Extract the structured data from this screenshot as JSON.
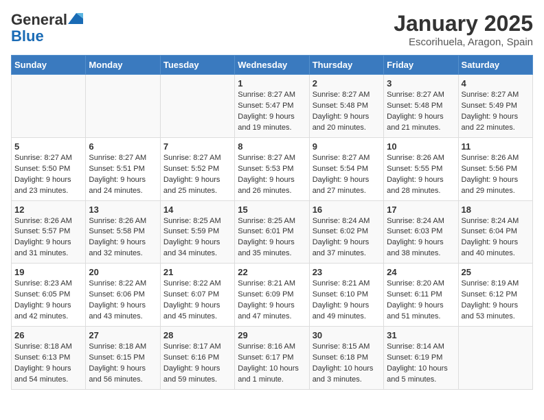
{
  "logo": {
    "general": "General",
    "blue": "Blue"
  },
  "title": "January 2025",
  "location": "Escorihuela, Aragon, Spain",
  "days_header": [
    "Sunday",
    "Monday",
    "Tuesday",
    "Wednesday",
    "Thursday",
    "Friday",
    "Saturday"
  ],
  "weeks": [
    [
      {
        "num": "",
        "sunrise": "",
        "sunset": "",
        "daylight": ""
      },
      {
        "num": "",
        "sunrise": "",
        "sunset": "",
        "daylight": ""
      },
      {
        "num": "",
        "sunrise": "",
        "sunset": "",
        "daylight": ""
      },
      {
        "num": "1",
        "sunrise": "Sunrise: 8:27 AM",
        "sunset": "Sunset: 5:47 PM",
        "daylight": "Daylight: 9 hours and 19 minutes."
      },
      {
        "num": "2",
        "sunrise": "Sunrise: 8:27 AM",
        "sunset": "Sunset: 5:48 PM",
        "daylight": "Daylight: 9 hours and 20 minutes."
      },
      {
        "num": "3",
        "sunrise": "Sunrise: 8:27 AM",
        "sunset": "Sunset: 5:48 PM",
        "daylight": "Daylight: 9 hours and 21 minutes."
      },
      {
        "num": "4",
        "sunrise": "Sunrise: 8:27 AM",
        "sunset": "Sunset: 5:49 PM",
        "daylight": "Daylight: 9 hours and 22 minutes."
      }
    ],
    [
      {
        "num": "5",
        "sunrise": "Sunrise: 8:27 AM",
        "sunset": "Sunset: 5:50 PM",
        "daylight": "Daylight: 9 hours and 23 minutes."
      },
      {
        "num": "6",
        "sunrise": "Sunrise: 8:27 AM",
        "sunset": "Sunset: 5:51 PM",
        "daylight": "Daylight: 9 hours and 24 minutes."
      },
      {
        "num": "7",
        "sunrise": "Sunrise: 8:27 AM",
        "sunset": "Sunset: 5:52 PM",
        "daylight": "Daylight: 9 hours and 25 minutes."
      },
      {
        "num": "8",
        "sunrise": "Sunrise: 8:27 AM",
        "sunset": "Sunset: 5:53 PM",
        "daylight": "Daylight: 9 hours and 26 minutes."
      },
      {
        "num": "9",
        "sunrise": "Sunrise: 8:27 AM",
        "sunset": "Sunset: 5:54 PM",
        "daylight": "Daylight: 9 hours and 27 minutes."
      },
      {
        "num": "10",
        "sunrise": "Sunrise: 8:26 AM",
        "sunset": "Sunset: 5:55 PM",
        "daylight": "Daylight: 9 hours and 28 minutes."
      },
      {
        "num": "11",
        "sunrise": "Sunrise: 8:26 AM",
        "sunset": "Sunset: 5:56 PM",
        "daylight": "Daylight: 9 hours and 29 minutes."
      }
    ],
    [
      {
        "num": "12",
        "sunrise": "Sunrise: 8:26 AM",
        "sunset": "Sunset: 5:57 PM",
        "daylight": "Daylight: 9 hours and 31 minutes."
      },
      {
        "num": "13",
        "sunrise": "Sunrise: 8:26 AM",
        "sunset": "Sunset: 5:58 PM",
        "daylight": "Daylight: 9 hours and 32 minutes."
      },
      {
        "num": "14",
        "sunrise": "Sunrise: 8:25 AM",
        "sunset": "Sunset: 5:59 PM",
        "daylight": "Daylight: 9 hours and 34 minutes."
      },
      {
        "num": "15",
        "sunrise": "Sunrise: 8:25 AM",
        "sunset": "Sunset: 6:01 PM",
        "daylight": "Daylight: 9 hours and 35 minutes."
      },
      {
        "num": "16",
        "sunrise": "Sunrise: 8:24 AM",
        "sunset": "Sunset: 6:02 PM",
        "daylight": "Daylight: 9 hours and 37 minutes."
      },
      {
        "num": "17",
        "sunrise": "Sunrise: 8:24 AM",
        "sunset": "Sunset: 6:03 PM",
        "daylight": "Daylight: 9 hours and 38 minutes."
      },
      {
        "num": "18",
        "sunrise": "Sunrise: 8:24 AM",
        "sunset": "Sunset: 6:04 PM",
        "daylight": "Daylight: 9 hours and 40 minutes."
      }
    ],
    [
      {
        "num": "19",
        "sunrise": "Sunrise: 8:23 AM",
        "sunset": "Sunset: 6:05 PM",
        "daylight": "Daylight: 9 hours and 42 minutes."
      },
      {
        "num": "20",
        "sunrise": "Sunrise: 8:22 AM",
        "sunset": "Sunset: 6:06 PM",
        "daylight": "Daylight: 9 hours and 43 minutes."
      },
      {
        "num": "21",
        "sunrise": "Sunrise: 8:22 AM",
        "sunset": "Sunset: 6:07 PM",
        "daylight": "Daylight: 9 hours and 45 minutes."
      },
      {
        "num": "22",
        "sunrise": "Sunrise: 8:21 AM",
        "sunset": "Sunset: 6:09 PM",
        "daylight": "Daylight: 9 hours and 47 minutes."
      },
      {
        "num": "23",
        "sunrise": "Sunrise: 8:21 AM",
        "sunset": "Sunset: 6:10 PM",
        "daylight": "Daylight: 9 hours and 49 minutes."
      },
      {
        "num": "24",
        "sunrise": "Sunrise: 8:20 AM",
        "sunset": "Sunset: 6:11 PM",
        "daylight": "Daylight: 9 hours and 51 minutes."
      },
      {
        "num": "25",
        "sunrise": "Sunrise: 8:19 AM",
        "sunset": "Sunset: 6:12 PM",
        "daylight": "Daylight: 9 hours and 53 minutes."
      }
    ],
    [
      {
        "num": "26",
        "sunrise": "Sunrise: 8:18 AM",
        "sunset": "Sunset: 6:13 PM",
        "daylight": "Daylight: 9 hours and 54 minutes."
      },
      {
        "num": "27",
        "sunrise": "Sunrise: 8:18 AM",
        "sunset": "Sunset: 6:15 PM",
        "daylight": "Daylight: 9 hours and 56 minutes."
      },
      {
        "num": "28",
        "sunrise": "Sunrise: 8:17 AM",
        "sunset": "Sunset: 6:16 PM",
        "daylight": "Daylight: 9 hours and 59 minutes."
      },
      {
        "num": "29",
        "sunrise": "Sunrise: 8:16 AM",
        "sunset": "Sunset: 6:17 PM",
        "daylight": "Daylight: 10 hours and 1 minute."
      },
      {
        "num": "30",
        "sunrise": "Sunrise: 8:15 AM",
        "sunset": "Sunset: 6:18 PM",
        "daylight": "Daylight: 10 hours and 3 minutes."
      },
      {
        "num": "31",
        "sunrise": "Sunrise: 8:14 AM",
        "sunset": "Sunset: 6:19 PM",
        "daylight": "Daylight: 10 hours and 5 minutes."
      },
      {
        "num": "",
        "sunrise": "",
        "sunset": "",
        "daylight": ""
      }
    ]
  ]
}
